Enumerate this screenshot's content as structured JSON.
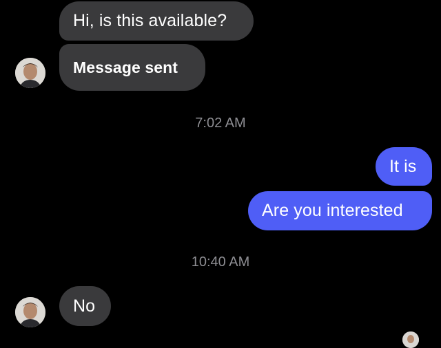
{
  "conversation": {
    "messages": [
      {
        "sender": "other",
        "text": "Hi, is this available?"
      },
      {
        "sender": "other",
        "text": "Message sent"
      },
      {
        "timestamp": "7:02 AM"
      },
      {
        "sender": "me",
        "text": "It is"
      },
      {
        "sender": "me",
        "text": "Are you interested"
      },
      {
        "timestamp": "10:40 AM"
      },
      {
        "sender": "other",
        "text": "No"
      }
    ]
  },
  "colors": {
    "background": "#000000",
    "incoming_bubble": "#3a3a3c",
    "outgoing_bubble": "#4f5ef6",
    "timestamp_text": "#8e8e93"
  },
  "icons": {
    "contact_avatar": "contact-avatar-icon",
    "my_avatar": "my-avatar-icon"
  }
}
